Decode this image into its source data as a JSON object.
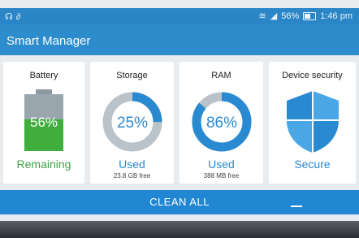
{
  "status_bar": {
    "left_icons": [
      "headset-icon",
      "link-icon"
    ],
    "battery_percent": "56%",
    "time": "1:46 pm"
  },
  "app": {
    "title": "Smart Manager"
  },
  "cards": {
    "battery": {
      "title": "Battery",
      "value": "56%",
      "status": "Remaining",
      "level": 0.56,
      "status_color": "#43a047"
    },
    "storage": {
      "title": "Storage",
      "value": "25%",
      "status": "Used",
      "sub": "23.8 GB free",
      "level": 0.25,
      "status_color": "#2a8ad1"
    },
    "ram": {
      "title": "RAM",
      "value": "86%",
      "status": "Used",
      "sub": "388 MB free",
      "level": 0.86,
      "status_color": "#2a8ad1"
    },
    "security": {
      "title": "Device security",
      "status": "Secure",
      "status_color": "#2a8ad1",
      "icon": "shield-icon"
    }
  },
  "action": {
    "label": "CLEAN ALL"
  },
  "colors": {
    "accent": "#2a8ad1",
    "green": "#43a047",
    "ring_track": "#b9c3c9"
  }
}
